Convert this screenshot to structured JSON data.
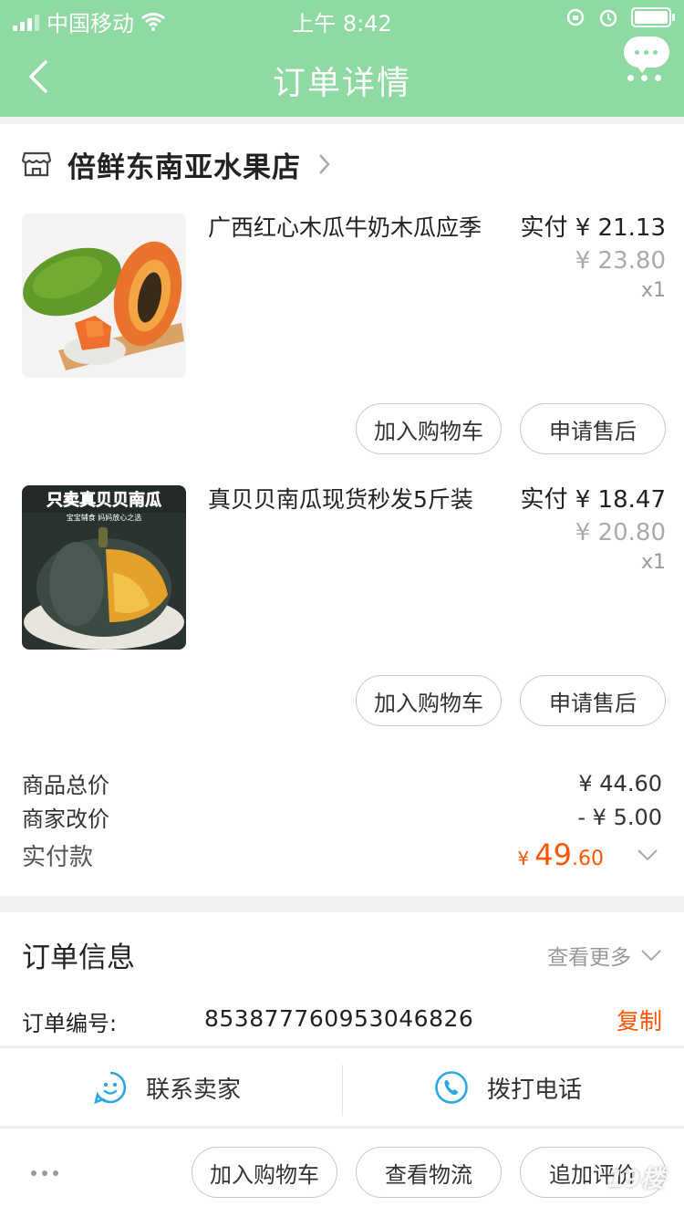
{
  "status_bar": {
    "carrier": "中国移动",
    "time": "上午 8:42"
  },
  "header": {
    "title": "订单详情"
  },
  "shop": {
    "name": "倍鲜东南亚水果店"
  },
  "items": [
    {
      "title": "广西红心木瓜牛奶木瓜应季",
      "pay_label": "实付",
      "pay_price": "¥ 21.13",
      "original_price": "¥ 23.80",
      "quantity": "x1",
      "add_cart_label": "加入购物车",
      "after_sale_label": "申请售后"
    },
    {
      "title": "真贝贝南瓜现货秒发5斤装",
      "pay_label": "实付",
      "pay_price": "¥ 18.47",
      "original_price": "¥ 20.80",
      "quantity": "x1",
      "thumb_banner": "只卖真贝贝南瓜",
      "thumb_sub": "宝宝辅食 妈妈放心之选",
      "add_cart_label": "加入购物车",
      "after_sale_label": "申请售后"
    }
  ],
  "summary": {
    "goods_total_label": "商品总价",
    "goods_total": "¥ 44.60",
    "adjust_label": "商家改价",
    "adjust": "- ¥ 5.00",
    "paid_label": "实付款",
    "paid_currency": "¥",
    "paid_int": "49",
    "paid_dec": ".60"
  },
  "order_info": {
    "title": "订单信息",
    "see_more": "查看更多",
    "order_no_label": "订单编号:",
    "order_no": "853877760953046826",
    "copy_label": "复制"
  },
  "contact": {
    "seller_label": "联系卖家",
    "call_label": "拨打电话"
  },
  "bottom_bar": {
    "add_cart": "加入购物车",
    "logistics": "查看物流",
    "review": "追加评价"
  },
  "watermark": "19楼",
  "colors": {
    "header": "#8fd9a3",
    "accent": "#ff5500",
    "contact_icon": "#2aa7e8"
  }
}
